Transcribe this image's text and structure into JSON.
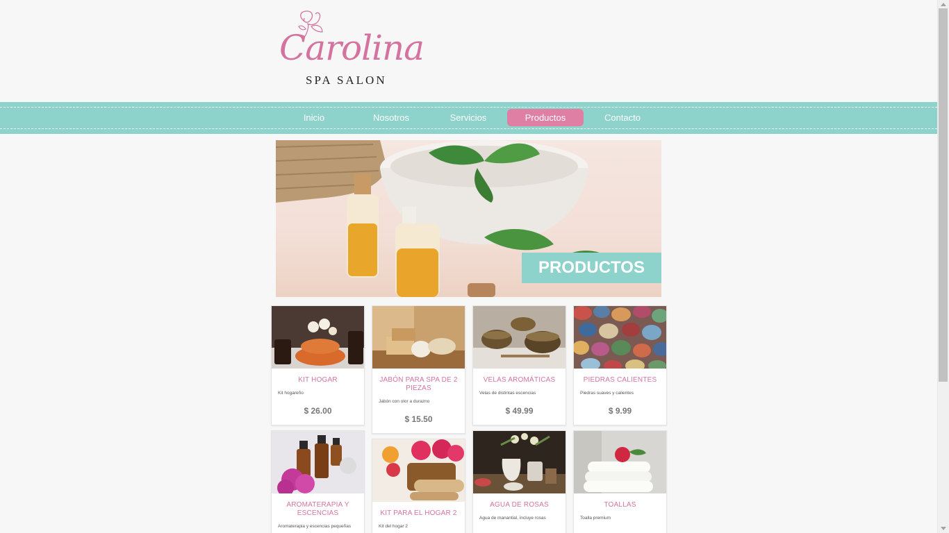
{
  "brand": {
    "name": "Carolina",
    "tagline": "SPA SALON"
  },
  "nav": {
    "items": [
      {
        "label": "Inicio"
      },
      {
        "label": "Nosotros"
      },
      {
        "label": "Servicios"
      },
      {
        "label": "Productos"
      },
      {
        "label": "Contacto"
      }
    ],
    "active": "Productos"
  },
  "hero": {
    "label": "PRODUCTOS"
  },
  "products": [
    {
      "title": "KIT HOGAR",
      "desc": "Kit hogareño",
      "price": "$ 26.00"
    },
    {
      "title": "JABÓN PARA SPA DE 2 PIEZAS",
      "desc": "Jabón con olor a durazno",
      "price": "$ 15.50"
    },
    {
      "title": "VELAS AROMÁTICAS",
      "desc": "Velas de distintas escencias",
      "price": "$ 49.99"
    },
    {
      "title": "PIEDRAS CALIENTES",
      "desc": "Piedras suaves y calientes",
      "price": "$ 9.99"
    },
    {
      "title": "AROMATERAPIA Y ESCENCIAS",
      "desc": "Aromaterapia y escencias pequeñas",
      "price": ""
    },
    {
      "title": "KIT PARA EL HOGAR 2",
      "desc": "Kit del hogar 2",
      "price": ""
    },
    {
      "title": "AGUA DE ROSAS",
      "desc": "Agua de manantial, incluye rosas",
      "price": ""
    },
    {
      "title": "TOALLAS",
      "desc": "Toalla premium",
      "price": ""
    }
  ],
  "colors": {
    "accent_teal": "#8dd3cb",
    "accent_pink": "#df7fa4",
    "title_pink": "#d4739f"
  }
}
